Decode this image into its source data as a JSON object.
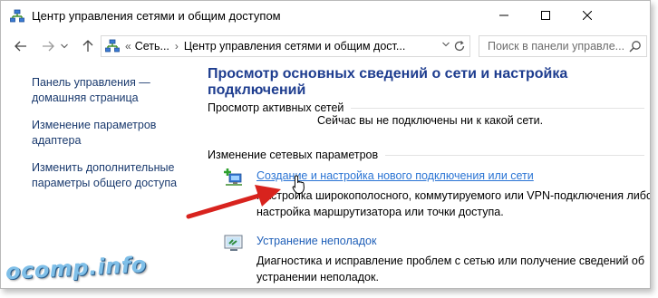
{
  "window": {
    "title": "Центр управления сетями и общим доступом"
  },
  "address": {
    "prefix": "«",
    "segments": [
      "Сеть...",
      "Центр управления сетями и общим дост..."
    ],
    "separator": "›"
  },
  "search": {
    "placeholder": "Поиск в панели управле..."
  },
  "sidebar": {
    "items": [
      {
        "label": "Панель управления — домашняя страница"
      },
      {
        "label": "Изменение параметров адаптера"
      },
      {
        "label": "Изменить дополнительные параметры общего доступа"
      }
    ]
  },
  "main": {
    "title": "Просмотр основных сведений о сети и настройка подключений",
    "active_networks_heading": "Просмотр активных сетей",
    "no_network_text": "Сейчас вы не подключены ни к какой сети.",
    "change_settings_heading": "Изменение сетевых параметров",
    "tasks": [
      {
        "icon": "new-connection-icon",
        "label": "Создание и настройка нового подключения или сети",
        "description": "Настройка широкополосного, коммутируемого или VPN-подключения либо настройка маршрутизатора или точки доступа."
      },
      {
        "icon": "troubleshoot-icon",
        "label": "Устранение неполадок",
        "description": "Диагностика и исправление проблем с сетью или получение сведений об устранении неполадок."
      }
    ]
  },
  "watermark": {
    "text": "ocomp.info"
  },
  "colors": {
    "link": "#1f5fb8",
    "title": "#1e3d8f",
    "sidebar_link": "#1a3a6e",
    "arrow": "#d8231e"
  }
}
